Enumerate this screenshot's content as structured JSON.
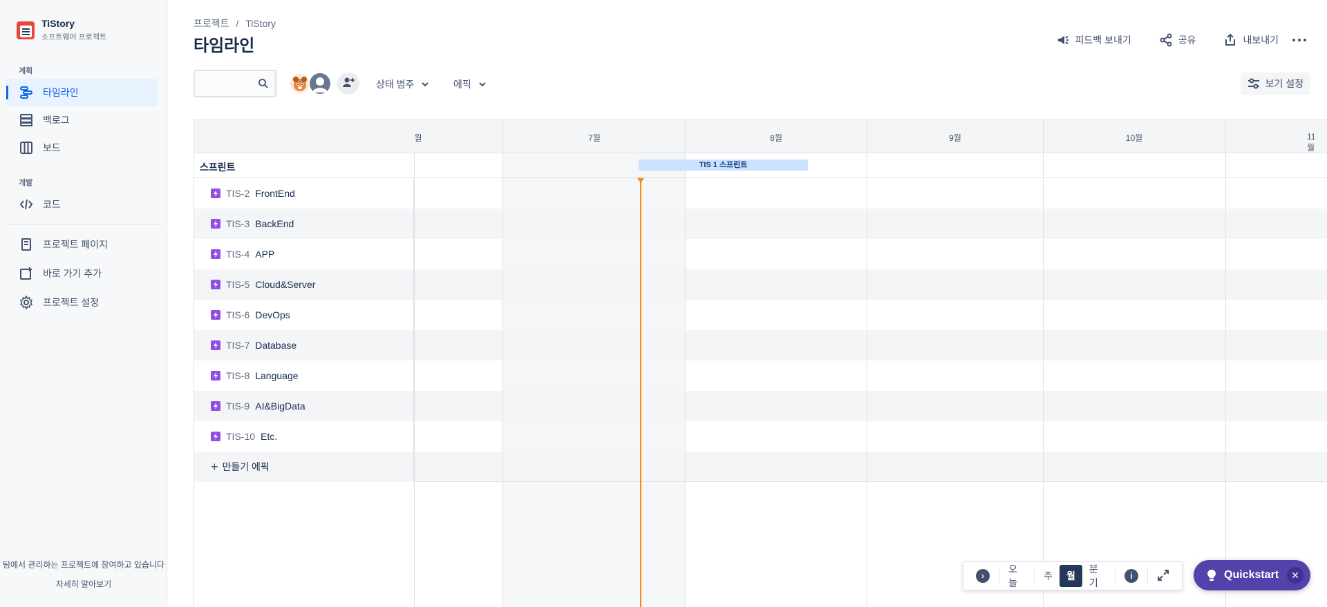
{
  "project": {
    "name": "TiStory",
    "type": "소프트웨어 프로젝트"
  },
  "sidebar": {
    "section_plan": "계획",
    "section_dev": "개발",
    "items": [
      {
        "label": "타임라인",
        "icon": "timeline-icon"
      },
      {
        "label": "백로그",
        "icon": "backlog-icon"
      },
      {
        "label": "보드",
        "icon": "board-icon"
      },
      {
        "label": "코드",
        "icon": "code-icon"
      },
      {
        "label": "프로젝트 페이지",
        "icon": "page-icon"
      },
      {
        "label": "바로 가기 추가",
        "icon": "add-shortcut-icon"
      },
      {
        "label": "프로젝트 설정",
        "icon": "gear-icon"
      }
    ],
    "footer_text": "팀에서 관리하는 프로젝트에 참여하고 있습니다",
    "footer_link": "자세히 알아보기"
  },
  "breadcrumb": {
    "root": "프로젝트",
    "separator": "/",
    "current": "TiStory"
  },
  "page_title": "타임라인",
  "header_actions": {
    "feedback": "피드백 보내기",
    "share": "공유",
    "export": "내보내기"
  },
  "toolbar": {
    "search_placeholder": "",
    "filter_status": "상태 범주",
    "filter_epic": "에픽",
    "view_settings": "보기 설정"
  },
  "timeline": {
    "months": [
      "월",
      "7월",
      "8월",
      "9월",
      "10월",
      "11월"
    ],
    "sprint_label": "스프린트",
    "sprint_name": "TIS 1 스프린트",
    "epics": [
      {
        "key": "TIS-2",
        "name": "FrontEnd"
      },
      {
        "key": "TIS-3",
        "name": "BackEnd"
      },
      {
        "key": "TIS-4",
        "name": "APP"
      },
      {
        "key": "TIS-5",
        "name": "Cloud&Server"
      },
      {
        "key": "TIS-6",
        "name": "DevOps"
      },
      {
        "key": "TIS-7",
        "name": "Database"
      },
      {
        "key": "TIS-8",
        "name": "Language"
      },
      {
        "key": "TIS-9",
        "name": "AI&BigData"
      },
      {
        "key": "TIS-10",
        "name": "Etc."
      }
    ],
    "create_epic": "만들기 에픽"
  },
  "zoom": {
    "today": "오늘",
    "week": "주",
    "month": "월",
    "quarter": "분기",
    "active": "월"
  },
  "quickstart": {
    "label": "Quickstart"
  },
  "colors": {
    "accent": "#0c66e4",
    "epic": "#904ee2",
    "today_line": "#f18d13",
    "quickstart": "#5243aa",
    "sprint_bar": "#cce0ff"
  }
}
